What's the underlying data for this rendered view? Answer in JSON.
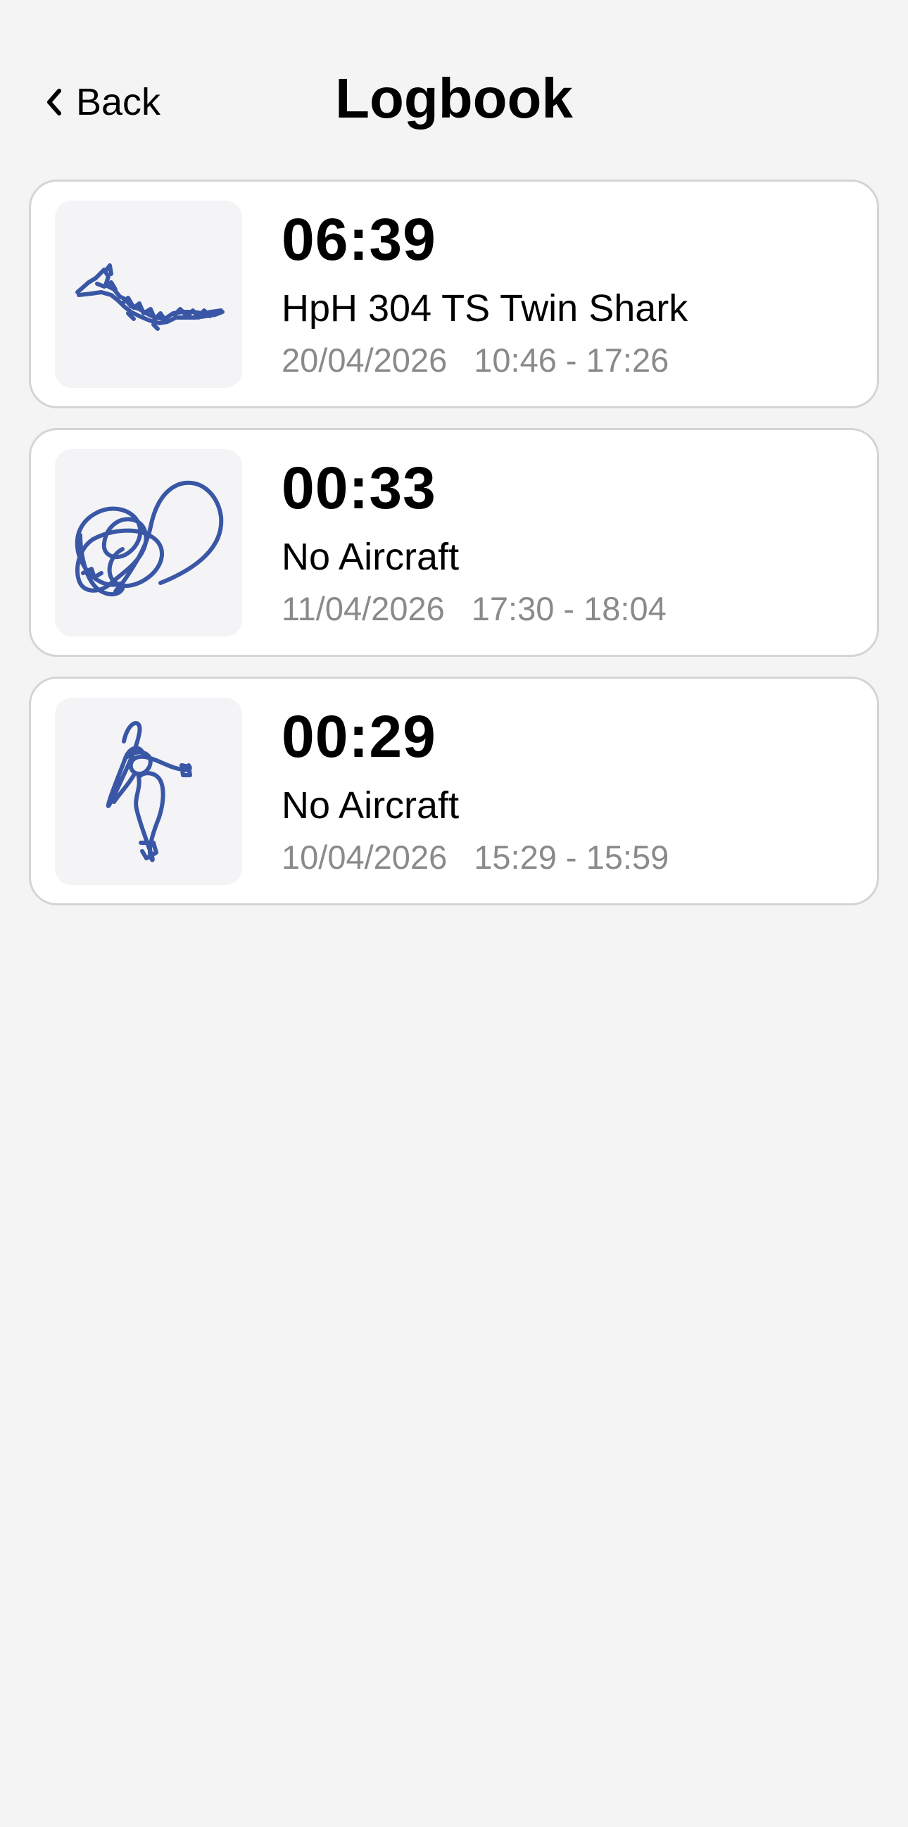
{
  "header": {
    "back_label": "Back",
    "title": "Logbook",
    "back_icon": "chevron-left-icon"
  },
  "colors": {
    "background": "#f4f4f4",
    "card": "#ffffff",
    "track": "#3a57a6",
    "secondary_text": "#8a8a8a"
  },
  "flights": [
    {
      "duration": "06:39",
      "aircraft": "HpH 304 TS Twin Shark",
      "date": "20/04/2026",
      "time_range": "10:46 - 17:26",
      "thumbnail": "flight-track-map"
    },
    {
      "duration": "00:33",
      "aircraft": "No Aircraft",
      "date": "11/04/2026",
      "time_range": "17:30 - 18:04",
      "thumbnail": "flight-track-map"
    },
    {
      "duration": "00:29",
      "aircraft": "No Aircraft",
      "date": "10/04/2026",
      "time_range": "15:29 - 15:59",
      "thumbnail": "flight-track-map"
    }
  ]
}
